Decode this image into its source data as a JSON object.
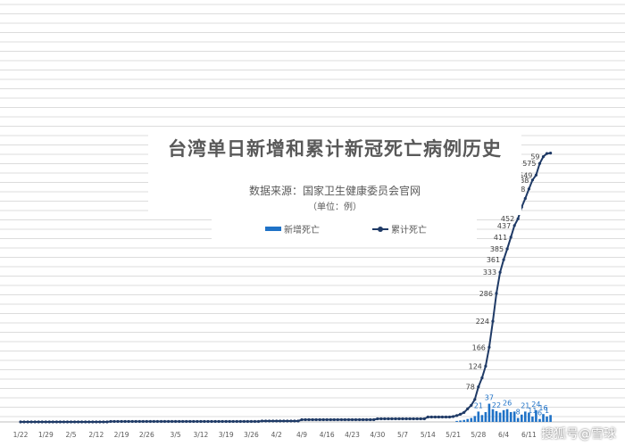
{
  "chart_data": {
    "type": "bar+line",
    "title": "台湾单日新增和累计新冠死亡病例历史",
    "subtitle": "数据来源：国家卫生健康委员会官网",
    "unit": "（单位：例）",
    "legend": [
      "新增死亡",
      "累计死亡"
    ],
    "legend_position": "top-center",
    "x_tick_labels": [
      "1/22",
      "1/29",
      "2/5",
      "2/12",
      "2/19",
      "2/26",
      "3/5",
      "3/12",
      "3/19",
      "3/26",
      "4/2",
      "4/9",
      "4/16",
      "4/23",
      "4/30",
      "5/7",
      "5/14",
      "5/21",
      "5/28",
      "6/4",
      "6/11"
    ],
    "grid": true,
    "series": [
      {
        "name": "新增死亡",
        "type": "bar",
        "color": "#1f72c7",
        "points": [
          {
            "date": "5/22",
            "value": 2
          },
          {
            "date": "5/23",
            "value": 3
          },
          {
            "date": "5/24",
            "value": 4
          },
          {
            "date": "5/25",
            "value": 6
          },
          {
            "date": "5/26",
            "value": 8
          },
          {
            "date": "5/27",
            "value": 12
          },
          {
            "date": "5/28",
            "value": 21
          },
          {
            "date": "5/29",
            "value": 14
          },
          {
            "date": "5/30",
            "value": 20
          },
          {
            "date": "5/31",
            "value": 37
          },
          {
            "date": "6/1",
            "value": 26
          },
          {
            "date": "6/2",
            "value": 22
          },
          {
            "date": "6/3",
            "value": 19
          },
          {
            "date": "6/4",
            "value": 24
          },
          {
            "date": "6/5",
            "value": 26
          },
          {
            "date": "6/6",
            "value": 20
          },
          {
            "date": "6/7",
            "value": 21
          },
          {
            "date": "6/8",
            "value": 8
          },
          {
            "date": "6/9",
            "value": 15
          },
          {
            "date": "6/10",
            "value": 21
          },
          {
            "date": "6/11",
            "value": 19
          },
          {
            "date": "6/12",
            "value": 11
          },
          {
            "date": "6/13",
            "value": 24
          },
          {
            "date": "6/14",
            "value": 6
          },
          {
            "date": "6/15",
            "value": 16
          },
          {
            "date": "6/16",
            "value": 11
          },
          {
            "date": "6/17",
            "value": 14
          }
        ],
        "labels": [
          {
            "date": "5/28",
            "text": "21"
          },
          {
            "date": "5/31",
            "text": "37"
          },
          {
            "date": "6/2",
            "text": "22"
          },
          {
            "date": "6/5",
            "text": "26"
          },
          {
            "date": "6/8",
            "text": "8"
          },
          {
            "date": "6/10",
            "text": "21"
          },
          {
            "date": "6/12",
            "text": "11"
          },
          {
            "date": "6/13",
            "text": "24"
          },
          {
            "date": "6/14",
            "text": "6"
          },
          {
            "date": "6/15",
            "text": "16"
          },
          {
            "date": "6/16",
            "text": "1"
          }
        ]
      },
      {
        "name": "累计死亡",
        "type": "line",
        "color": "#1f3a66",
        "points": [
          {
            "date": "1/22",
            "value": 0
          },
          {
            "date": "2/16",
            "value": 1
          },
          {
            "date": "3/29",
            "value": 2
          },
          {
            "date": "4/9",
            "value": 5
          },
          {
            "date": "4/30",
            "value": 7
          },
          {
            "date": "5/14",
            "value": 11
          },
          {
            "date": "5/21",
            "value": 12
          },
          {
            "date": "5/22",
            "value": 14
          },
          {
            "date": "5/23",
            "value": 17
          },
          {
            "date": "5/24",
            "value": 21
          },
          {
            "date": "5/25",
            "value": 29
          },
          {
            "date": "5/26",
            "value": 37
          },
          {
            "date": "5/27",
            "value": 50
          },
          {
            "date": "5/28",
            "value": 78
          },
          {
            "date": "5/29",
            "value": 98
          },
          {
            "date": "5/30",
            "value": 124
          },
          {
            "date": "5/31",
            "value": 166
          },
          {
            "date": "6/1",
            "value": 224
          },
          {
            "date": "6/2",
            "value": 286
          },
          {
            "date": "6/3",
            "value": 333
          },
          {
            "date": "6/4",
            "value": 361
          },
          {
            "date": "6/5",
            "value": 385
          },
          {
            "date": "6/6",
            "value": 411
          },
          {
            "date": "6/7",
            "value": 437
          },
          {
            "date": "6/8",
            "value": 452
          },
          {
            "date": "6/9",
            "value": 478
          },
          {
            "date": "6/10",
            "value": 497
          },
          {
            "date": "6/11",
            "value": 518
          },
          {
            "date": "6/12",
            "value": 538
          },
          {
            "date": "6/13",
            "value": 549
          },
          {
            "date": "6/14",
            "value": 575
          },
          {
            "date": "6/15",
            "value": 590
          },
          {
            "date": "6/16",
            "value": 597
          },
          {
            "date": "6/17",
            "value": 598
          }
        ],
        "labels": [
          {
            "date": "5/28",
            "text": "78"
          },
          {
            "date": "5/30",
            "text": "124"
          },
          {
            "date": "5/31",
            "text": "166"
          },
          {
            "date": "6/1",
            "text": "224"
          },
          {
            "date": "6/2",
            "text": "286"
          },
          {
            "date": "6/3",
            "text": "333"
          },
          {
            "date": "6/4",
            "text": "361"
          },
          {
            "date": "6/5",
            "text": "385"
          },
          {
            "date": "6/6",
            "text": "411"
          },
          {
            "date": "6/7",
            "text": "437"
          },
          {
            "date": "6/8",
            "text": "452"
          },
          {
            "date": "6/9",
            "text": "478"
          },
          {
            "date": "6/10",
            "text": "497"
          },
          {
            "date": "6/11",
            "text": "518"
          },
          {
            "date": "6/12",
            "text": "538"
          },
          {
            "date": "6/13",
            "text": "549"
          },
          {
            "date": "6/14",
            "text": "575"
          },
          {
            "date": "6/15",
            "text": "59"
          }
        ]
      }
    ]
  },
  "watermark": "搜狐号@雪球"
}
